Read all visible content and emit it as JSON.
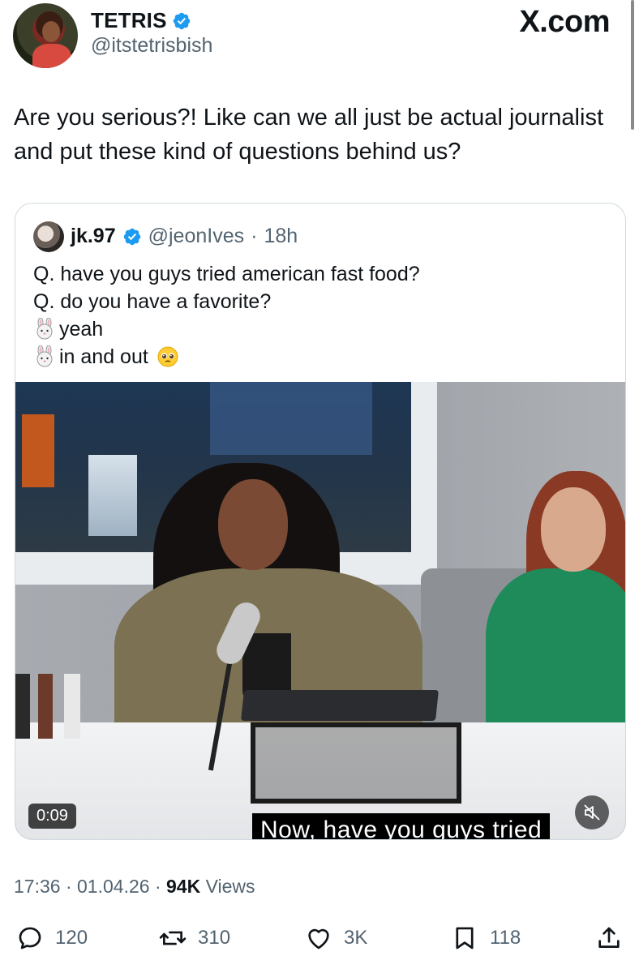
{
  "author": {
    "display_name": "TETRIS",
    "handle": "@itstetrisbish",
    "verified": true
  },
  "brand": {
    "site": "X.com"
  },
  "tweet": {
    "text": "Are you serious?! Like can we all just be actual journalist and put these kind of questions behind us?"
  },
  "quoted": {
    "display_name": "jk.97",
    "handle": "@jeonIves",
    "separator": "·",
    "time": "18h",
    "lines": [
      "Q. have you guys tried american fast food?",
      "Q. do you have a favorite?",
      "yeah",
      "in and out"
    ],
    "line_emojis": [
      "",
      "",
      "bunny-face",
      "bunny-face"
    ],
    "trailing_emoji": "pleading-face",
    "video": {
      "duration": "0:09",
      "caption": "Now, have you guys tried",
      "muted": true
    }
  },
  "meta": {
    "time": "17:36",
    "sep1": "·",
    "date": "01.04.26",
    "sep2": "·",
    "views_count": "94K",
    "views_label": "Views"
  },
  "actions": {
    "replies": "120",
    "reposts": "310",
    "likes": "3K",
    "bookmarks": "118"
  },
  "colors": {
    "verified_blue": "#1d9bf0",
    "secondary_text": "#536471",
    "primary_text": "#0f1419",
    "border": "#cfd9de"
  }
}
